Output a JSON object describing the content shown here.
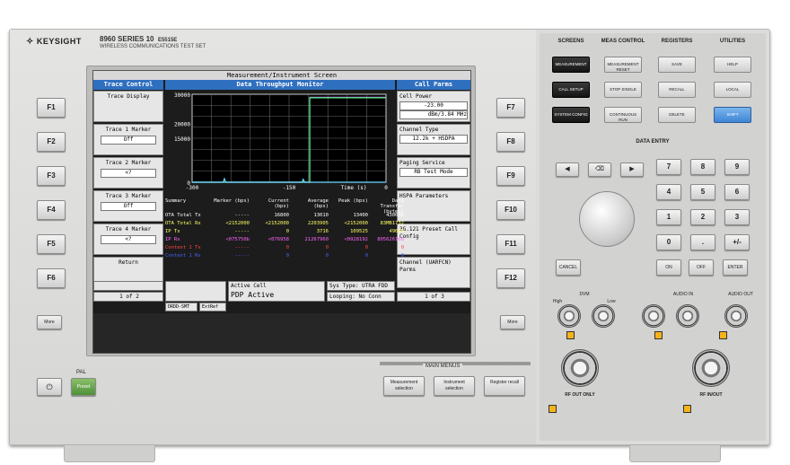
{
  "brand": {
    "name": "KEYSIGHT",
    "model": "8960 SERIES 10",
    "submodel": "E5515E",
    "subtitle": "WIRELESS COMMUNICATIONS TEST SET"
  },
  "screen": {
    "title": "Measurement/Instrument Screen",
    "left_header": "Trace Control",
    "center_header": "Data Throughput Monitor",
    "right_header": "Call Parms",
    "left_softkeys": [
      {
        "label": "Trace Display",
        "value": ""
      },
      {
        "label": "Trace 1 Marker",
        "value": "Off"
      },
      {
        "label": "Trace 2 Marker",
        "value": "<?"
      },
      {
        "label": "Trace 3 Marker",
        "value": "Off"
      },
      {
        "label": "Trace 4 Marker",
        "value": "<?"
      },
      {
        "label": "Return",
        "value": ""
      }
    ],
    "right_softkeys": [
      {
        "label": "Cell Power",
        "value": "-23.00",
        "value2": "dBm/3.84 MHz"
      },
      {
        "label": "Channel Type",
        "value": "12.2k + HSDPA"
      },
      {
        "label": "Paging Service",
        "value": "RB Test Mode"
      },
      {
        "label": "HSPA Parameters",
        "value": ""
      },
      {
        "label": "3G.121 Preset Call Config",
        "value": ""
      },
      {
        "label": "Channel (UARFCN) Parms",
        "value": ""
      }
    ],
    "page_left": "1 of 2",
    "page_right": "1 of 3",
    "status": {
      "active_cell_label": "Active Cell",
      "active_cell_value": "PDP Active",
      "sys_type": "Sys Type: UTRA FDD",
      "looping": "Looping: No Conn",
      "ext_ref": "ExtRef",
      "mode": "DRDD-SMT"
    }
  },
  "chart_data": {
    "type": "line",
    "title": "Data Throughput Monitor",
    "xlabel": "Time (s)",
    "ylabel": "",
    "x_ticks": [
      "-300",
      "-150",
      "0"
    ],
    "y_ticks": [
      "30000",
      "20000",
      "15000",
      "0"
    ],
    "ylim": [
      0,
      30000
    ],
    "xlim": [
      -300,
      0
    ],
    "series": [
      {
        "color": "#ff44ff",
        "points": [
          [
            -300,
            0
          ],
          [
            -118,
            0
          ],
          [
            -118,
            29000
          ],
          [
            0,
            29000
          ]
        ]
      },
      {
        "color": "#44ff88",
        "points": [
          [
            -300,
            0
          ],
          [
            -118,
            0
          ],
          [
            -118,
            28800
          ],
          [
            0,
            28800
          ]
        ]
      },
      {
        "color": "#66ddff",
        "points": [
          [
            -300,
            0
          ],
          [
            -252,
            0
          ],
          [
            -250,
            1200
          ],
          [
            -248,
            0
          ],
          [
            -130,
            0
          ],
          [
            -128,
            1000
          ],
          [
            -126,
            0
          ],
          [
            0,
            0
          ]
        ]
      }
    ],
    "summary": {
      "headers": [
        "Summary",
        "Marker (bps)",
        "Current (bps)",
        "Average (bps)",
        "Peak (bps)",
        "Data Transfer (bytes)"
      ],
      "rows": [
        {
          "name": "OTA Total Tx",
          "color": "#ffffff",
          "cells": [
            "-----",
            "16800",
            "13010",
            "13400",
            "430036"
          ]
        },
        {
          "name": "OTA Total Rx",
          "color": "#ffff66",
          "cells": [
            "<2152000",
            "<2152000",
            "2203905",
            "<2152000",
            "83MB1732"
          ]
        },
        {
          "name": "IP Tx",
          "color": "#ffff66",
          "cells": [
            "-----",
            "0",
            "3716",
            "109525",
            "49020"
          ]
        },
        {
          "name": "IP Rx",
          "color": "#ff66ff",
          "cells": [
            "<075750b",
            "<076958",
            "21267960",
            "<0928192",
            "805626168"
          ]
        },
        {
          "name": "Context 1 Tx",
          "color": "#ff4444",
          "cells": [
            "-----",
            "0",
            "0",
            "0",
            "0"
          ]
        },
        {
          "name": "Context 1 Rx",
          "color": "#4466ff",
          "cells": [
            "-----",
            "0",
            "0",
            "0",
            "0"
          ]
        }
      ]
    }
  },
  "fkeys_left": [
    "F1",
    "F2",
    "F3",
    "F4",
    "F5",
    "F6"
  ],
  "fkeys_right": [
    "F7",
    "F8",
    "F9",
    "F10",
    "F11",
    "F12"
  ],
  "front": {
    "more_left": "More",
    "more_right": "More",
    "pal": "PAL",
    "preset": "Preset",
    "main_menus": "MAIN MENUS",
    "menu_buttons": [
      "Measurement selection",
      "Instrument selection",
      "Register recall"
    ]
  },
  "right": {
    "groups": [
      "SCREENS",
      "MEAS CONTROL",
      "REGISTERS",
      "UTILITIES"
    ],
    "screen_keys": [
      "MEASUREMENT",
      "CALL SETUP",
      "SYSTEM CONFIG"
    ],
    "meas_keys": [
      "MEASUREMENT RESET",
      "STOP SINGLE",
      "CONTINUOUS RUN"
    ],
    "reg_keys": [
      "SAVE",
      "RECALL",
      "DELETE"
    ],
    "util_keys": [
      "HELP",
      "LOCAL",
      "SHIFT"
    ],
    "data_entry": "DATA ENTRY",
    "numpad": [
      "7",
      "8",
      "9",
      "4",
      "5",
      "6",
      "1",
      "2",
      "3",
      "0",
      ".",
      "+/-"
    ],
    "entry_keys": [
      "CANCEL",
      "ON",
      "OFF",
      "ENTER"
    ],
    "ports": {
      "dvm": "DVM",
      "audio_in": "AUDIO IN",
      "audio_out": "AUDIO OUT",
      "rf_out": "RF OUT ONLY",
      "rf_inout": "RF IN/OUT",
      "high": "High",
      "low": "Low"
    }
  },
  "colors": {
    "panel": "#dcdcda",
    "screen_bg": "#1c1c1c",
    "header_blue": "#2f6fc0",
    "magenta": "#ff44ff",
    "green": "#44ff88"
  }
}
